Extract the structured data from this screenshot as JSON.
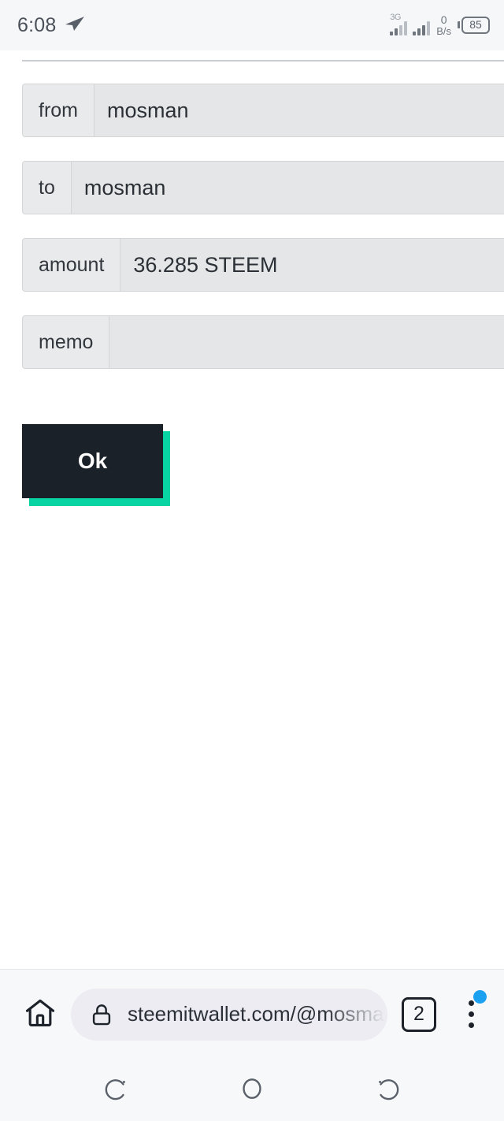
{
  "status_bar": {
    "time": "6:08",
    "telegram_icon": "paper-plane-icon",
    "network_type": "3G",
    "data_rate_value": "0",
    "data_rate_unit": "B/s",
    "battery_percent": "85"
  },
  "form": {
    "rows": [
      {
        "label": "from",
        "value": "mosman"
      },
      {
        "label": "to",
        "value": "mosman"
      },
      {
        "label": "amount",
        "value": "36.285 STEEM"
      },
      {
        "label": "memo",
        "value": ""
      }
    ]
  },
  "actions": {
    "ok_label": "Ok"
  },
  "browser": {
    "home_icon": "home-icon",
    "lock_icon": "lock-icon",
    "url": "steemitwallet.com/@mosman",
    "tab_count": "2",
    "menu_icon": "more-vertical-icon"
  },
  "navigation": {
    "recents_icon": "recents-icon",
    "home_icon": "home-circle-icon",
    "back_icon": "back-icon"
  },
  "colors": {
    "accent_teal": "#07d3a3",
    "button_dark": "#1b2129",
    "badge_blue": "#1ca0f0",
    "field_bg": "#e5e6e7",
    "chrome_bg": "#f7f8fa"
  }
}
